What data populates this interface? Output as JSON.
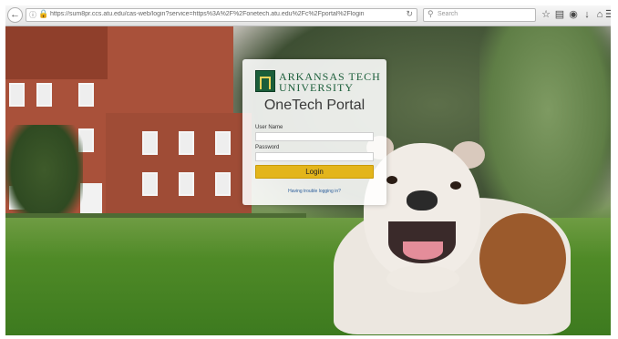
{
  "browser": {
    "url": "https://sum8pr.ccs.atu.edu/cas-web/login?service=https%3A%2F%2Fonetech.atu.edu%2Fc%2Fportal%2Flogin",
    "search_placeholder": "Search"
  },
  "login_card": {
    "logo_line1": "ARKANSAS TECH",
    "logo_line2": "UNIVERSITY",
    "title": "OneTech Portal",
    "username_label": "User Name",
    "password_label": "Password",
    "login_button": "Login",
    "help_link": "Having trouble logging in?"
  },
  "colors": {
    "accent_button": "#e3b51b",
    "brand_green": "#1b5e3a"
  },
  "icons": [
    "back-icon",
    "info-icon",
    "lock-icon",
    "reload-icon",
    "search-icon",
    "star-icon",
    "bookmarks-icon",
    "pocket-icon",
    "download-icon",
    "home-icon",
    "menu-icon"
  ]
}
